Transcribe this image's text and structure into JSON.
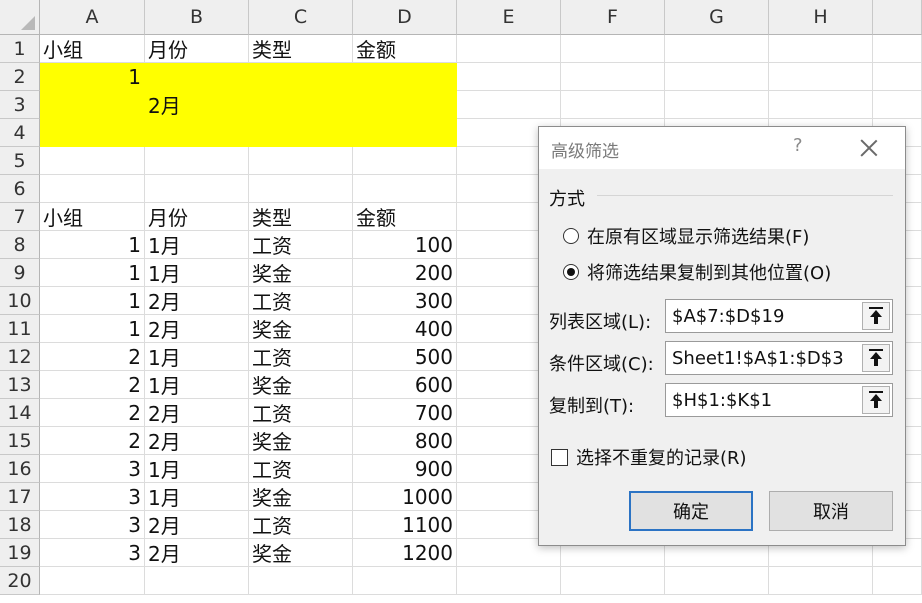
{
  "columns": [
    "A",
    "B",
    "C",
    "D",
    "E",
    "F",
    "G",
    "H"
  ],
  "rows": [
    "1",
    "2",
    "3",
    "4",
    "5",
    "6",
    "7",
    "8",
    "9",
    "10",
    "11",
    "12",
    "13",
    "14",
    "15",
    "16",
    "17",
    "18",
    "19",
    "20"
  ],
  "criteria": {
    "header": [
      "小组",
      "月份",
      "类型",
      "金额"
    ],
    "group_value": "1",
    "month_value": "2月"
  },
  "table": {
    "header": [
      "小组",
      "月份",
      "类型",
      "金额"
    ],
    "data": [
      [
        "1",
        "1月",
        "工资",
        "100"
      ],
      [
        "1",
        "1月",
        "奖金",
        "200"
      ],
      [
        "1",
        "2月",
        "工资",
        "300"
      ],
      [
        "1",
        "2月",
        "奖金",
        "400"
      ],
      [
        "2",
        "1月",
        "工资",
        "500"
      ],
      [
        "2",
        "1月",
        "奖金",
        "600"
      ],
      [
        "2",
        "2月",
        "工资",
        "700"
      ],
      [
        "2",
        "2月",
        "奖金",
        "800"
      ],
      [
        "3",
        "1月",
        "工资",
        "900"
      ],
      [
        "3",
        "1月",
        "奖金",
        "1000"
      ],
      [
        "3",
        "2月",
        "工资",
        "1100"
      ],
      [
        "3",
        "2月",
        "奖金",
        "1200"
      ]
    ]
  },
  "colors": {
    "criteria_fill": "#ffff00",
    "ok_border": "#2b73c4"
  },
  "dialog": {
    "title": "高级筛选",
    "help": "?",
    "group_label": "方式",
    "radio_in_place": "在原有区域显示筛选结果(F)",
    "radio_copy": "将筛选结果复制到其他位置(O)",
    "list_range_label": "列表区域(L):",
    "list_range_value": "$A$7:$D$19",
    "criteria_range_label": "条件区域(C):",
    "criteria_range_value": "Sheet1!$A$1:$D$3",
    "copy_to_label": "复制到(T):",
    "copy_to_value": "$H$1:$K$1",
    "unique_label": "选择不重复的记录(R)",
    "ok_label": "确定",
    "cancel_label": "取消",
    "selected_option": "copy"
  }
}
